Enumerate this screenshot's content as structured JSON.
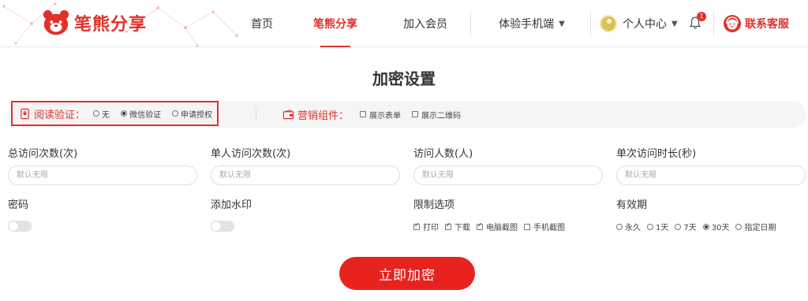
{
  "header": {
    "logo_text": "笔熊分享",
    "nav": {
      "home": "首页",
      "share": "笔熊分享",
      "member": "加入会员",
      "mobile": "体验手机端"
    },
    "user_center": "个人中心",
    "notification_count": "1",
    "support": "联系客服",
    "accent_color": "#e0312b"
  },
  "page": {
    "title": "加密设置"
  },
  "settings_bar": {
    "read_verify": {
      "label": "阅读验证：",
      "options": [
        "无",
        "微信验证",
        "申请授权"
      ],
      "selected": "微信验证"
    },
    "marketing": {
      "label": "营销组件：",
      "options": [
        "展示表单",
        "展示二维码"
      ]
    }
  },
  "fields": {
    "total_visits": {
      "label": "总访问次数(次)",
      "placeholder": "默认无限"
    },
    "single_visits": {
      "label": "单人访问次数(次)",
      "placeholder": "默认无限"
    },
    "visitors": {
      "label": "访问人数(人)",
      "placeholder": "默认无限"
    },
    "single_duration": {
      "label": "单次访问时长(秒)",
      "placeholder": "默认无限"
    },
    "password": {
      "label": "密码",
      "enabled": false
    },
    "watermark": {
      "label": "添加水印",
      "enabled": false
    },
    "restrictions": {
      "label": "限制选项",
      "options": [
        "打印",
        "下载",
        "电脑截图",
        "手机截图"
      ],
      "checked": [
        "打印",
        "下载",
        "电脑截图"
      ]
    },
    "validity": {
      "label": "有效期",
      "options": [
        "永久",
        "1天",
        "7天",
        "30天",
        "指定日期"
      ],
      "selected": "30天"
    }
  },
  "submit_label": "立即加密"
}
